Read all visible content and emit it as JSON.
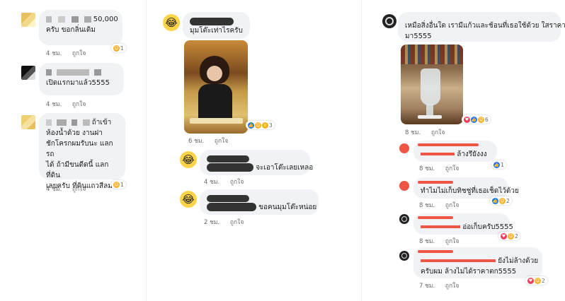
{
  "panel1": {
    "comments": [
      {
        "text_tail": "50,000",
        "text_line2": "ครับ ขอกลิ่นเดิม",
        "time": "4 ชม.",
        "like": "ถูกใจ",
        "reaction_count": "1"
      },
      {
        "text_line2": "เปิดแรกมาแล้ว5555",
        "time": "4 ชม.",
        "like": "ถูกใจ"
      },
      {
        "text_tail": "ถ้าเข้า",
        "lines": [
          "ห้องน้ำด้วย งานฝา",
          "ชักโครกผมรับนะ แลกรถ",
          "ได้ ถ้ามีขนดีดนี้ แลกที่ดิน",
          "เลยครับ ที่ดินแถวสีลม"
        ],
        "time": "4 ชม.",
        "like": "ถูกใจ",
        "reaction_count": "1"
      }
    ]
  },
  "panel2": {
    "comments": [
      {
        "text": "มุมโต๊ะเท่าไรครับ",
        "time": "6 ชม.",
        "like": "ถูกใจ",
        "reaction_count": "3"
      },
      {
        "text": "จะเอาโต๊ะเลยเหลอ",
        "time": "4 ชม.",
        "like": "ถูกใจ"
      },
      {
        "text": "ขอคนมุมโต๊ะหน่อย",
        "time": "2 ชม.",
        "like": "ถูกใจ"
      }
    ]
  },
  "panel3": {
    "comments": [
      {
        "lines": [
          "เหมือสิ่งอื่นใด เรามีแก้วและช้อนที่เธอใช้ด้วย ใสราคา",
          "มา5555"
        ],
        "time": "8 ชม.",
        "like": "ถูกใจ",
        "reaction_count": "6"
      },
      {
        "text": "ล้างรึยังงง",
        "time": "8 ชม.",
        "like": "ถูกใจ",
        "reaction_count": "1"
      },
      {
        "text": "ทำไมไม่เก็บทิชชู่ที่เธอเช็ดไว้ด้วย",
        "time": "8 ชม.",
        "like": "ถูกใจ",
        "reaction_count": "2"
      },
      {
        "text": "อ่อเก็บครับ5555",
        "time": "8 ชม.",
        "like": "ถูกใจ",
        "reaction_count": "2"
      },
      {
        "lines": [
          "ยังไม่ล้างด้วย",
          "ครับผม ล้างไม่ได้ราคาตก5555"
        ],
        "time": "7 ชม.",
        "like": "ถูกใจ",
        "reaction_count": "2"
      }
    ]
  }
}
